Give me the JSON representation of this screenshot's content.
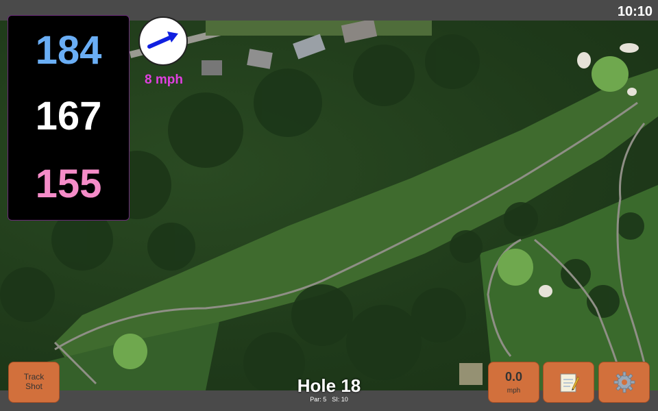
{
  "status": {
    "time": "10:10"
  },
  "distances": {
    "back": "184",
    "middle": "167",
    "front": "155"
  },
  "wind": {
    "speed": "8 mph",
    "icon": "wind-direction-arrow-icon"
  },
  "buttons": {
    "track_shot": "Track\nShot",
    "speed_value": "0.0",
    "speed_unit": "mph",
    "scorecard_icon": "notepad-icon",
    "settings_icon": "gear-icon"
  },
  "hole": {
    "title": "Hole 18",
    "par": "Par: 5",
    "si": "SI: 10"
  },
  "colors": {
    "back": "#6aaef5",
    "middle": "#ffffff",
    "front": "#f58cc8",
    "wind_text": "#e040e0",
    "button": "#d2703c"
  }
}
